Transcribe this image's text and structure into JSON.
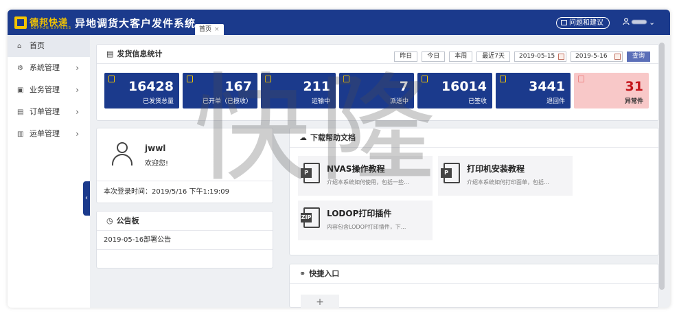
{
  "header": {
    "logo_text": "德邦快递",
    "logo_sub": "DEPPON EXPRESS",
    "app_title": "异地调货大客户发件系统",
    "tab_home": "首页",
    "tab_close": "×",
    "feedback": "问题和建议",
    "user_icon": "person-icon",
    "dropdown": "⌄"
  },
  "sidebar": {
    "items": [
      {
        "label": "首页",
        "icon": "home-icon"
      },
      {
        "label": "系统管理",
        "icon": "gear-icon"
      },
      {
        "label": "业务管理",
        "icon": "briefcase-icon"
      },
      {
        "label": "订单管理",
        "icon": "order-icon"
      },
      {
        "label": "运单管理",
        "icon": "waybill-icon"
      }
    ],
    "collapse": "‹"
  },
  "stats": {
    "title": "发货信息统计",
    "filters": [
      "昨日",
      "今日",
      "本周",
      "最近7天"
    ],
    "date_from": "2019-05-15",
    "date_to": "2019-5-16",
    "query": "查询",
    "cards": [
      {
        "value": "16428",
        "label": "已发货总量"
      },
      {
        "value": "167",
        "label": "已开单（已揽收）"
      },
      {
        "value": "211",
        "label": "运输中"
      },
      {
        "value": "7",
        "label": "派送中"
      },
      {
        "value": "16014",
        "label": "已签收"
      },
      {
        "value": "3441",
        "label": "退回件"
      },
      {
        "value": "31",
        "label": "异常件"
      }
    ],
    "colors": {
      "card": "#1b3a8c",
      "alert_bg": "#f8c8c8",
      "alert_text": "#c4141a"
    }
  },
  "user": {
    "name": "jwwl",
    "welcome": "欢迎您!",
    "last_login": "本次登录时间：2019/5/16 下午1:19:09"
  },
  "notice": {
    "title": "公告板",
    "items": [
      "2019-05-16部署公告"
    ]
  },
  "docs": {
    "title": "下载帮助文档",
    "items": [
      {
        "title": "NVAS操作教程",
        "desc": "介绍本系统如何使用，包括一些...",
        "badge": "P"
      },
      {
        "title": "打印机安装教程",
        "desc": "介绍本系统如何打印面单，包括...",
        "badge": "P"
      },
      {
        "title": "LODOP打印插件",
        "desc": "内容包含LODOP打印插件，下...",
        "badge": "ZIP"
      }
    ]
  },
  "quick": {
    "title": "快捷入口",
    "add": "+"
  },
  "watermark": "快隆"
}
